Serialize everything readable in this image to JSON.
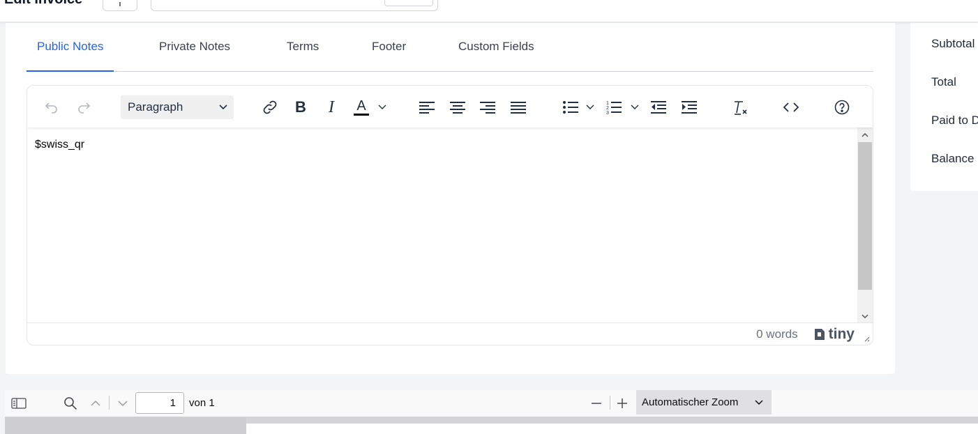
{
  "header": {
    "title": "Edit Invoice"
  },
  "tabs": [
    {
      "label": "Public Notes",
      "active": true
    },
    {
      "label": "Private Notes",
      "active": false
    },
    {
      "label": "Terms",
      "active": false
    },
    {
      "label": "Footer",
      "active": false
    },
    {
      "label": "Custom Fields",
      "active": false
    }
  ],
  "editor": {
    "block_format": "Paragraph",
    "content": "$swiss_qr",
    "word_count": "0 words",
    "brand": "tiny",
    "toolbar_icons": [
      "undo-icon",
      "redo-icon",
      "link-icon",
      "bold-icon",
      "italic-icon",
      "text-color-icon",
      "align-left-icon",
      "align-center-icon",
      "align-right-icon",
      "justify-icon",
      "bullet-list-icon",
      "numbered-list-icon",
      "outdent-icon",
      "indent-icon",
      "clear-formatting-icon",
      "source-code-icon",
      "help-icon"
    ],
    "text_color": "#000000"
  },
  "summary": {
    "rows": [
      "Subtotal",
      "Total",
      "Paid to D",
      "Balance"
    ]
  },
  "pdf_viewer": {
    "page_number": "1",
    "page_count": "von 1",
    "zoom": "Automatischer Zoom"
  },
  "colors": {
    "accent": "#2563eb"
  }
}
